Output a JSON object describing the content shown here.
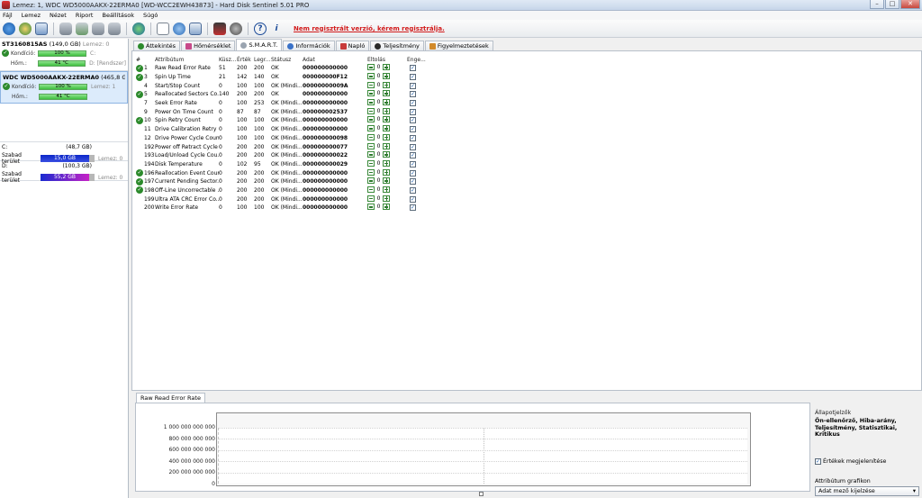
{
  "window": {
    "title": "Lemez: 1, WDC WD5000AAKX-22ERMA0 [WD-WCC2EWH43873]  -  Hard Disk Sentinel 5.01 PRO",
    "controls": {
      "minimize": "–",
      "maximize": "□",
      "close": "✕"
    }
  },
  "menu": [
    "Fájl",
    "Lemez",
    "Nézet",
    "Riport",
    "Beállítások",
    "Súgó"
  ],
  "toolbar": {
    "registration_note": "Nem regisztrált verzió, kérem regisztrálja.",
    "icons": [
      "refresh-icon",
      "disk-scan-icon",
      "report-icon",
      "disk-icon",
      "disk-icon",
      "disk-icon",
      "disk-icon",
      "globe-icon",
      "document-icon",
      "refresh-circle-icon",
      "email-icon",
      "chart-icon",
      "settings-icon",
      "help-icon",
      "info-icon"
    ],
    "help_glyph": "?",
    "info_glyph": "i"
  },
  "disks": [
    {
      "name": "ST3160815AS",
      "size": "(149,0 GB)",
      "lemez": "Lemez: 0",
      "cond_label": "Kondíció:",
      "cond_value": "100 %",
      "temp_label": "Hőm.:",
      "temp_value": "41 °C",
      "vol1": "C:",
      "vol2": "D:",
      "vol2_extra": "[Rendszer]",
      "selected": false
    },
    {
      "name": "WDC WD5000AAKX-22ERMA0",
      "size": "(465,8 GB)",
      "lemez": "Lemez: 1",
      "cond_label": "Kondíció:",
      "cond_value": "100 %",
      "temp_label": "Hőm.:",
      "temp_value": "41 °C",
      "selected": true
    }
  ],
  "volumes": [
    {
      "letter": "C:",
      "size": "(48,7 GB)",
      "free_label": "Szabad terület",
      "free_value": "15,0 GB",
      "lemez": "Lemez: 0",
      "free_fraction": 0.31
    },
    {
      "letter": "D:",
      "size": "(100,3 GB)",
      "free_label": "Szabad terület",
      "free_value": "55,2 GB",
      "lemez": "Lemez: 0",
      "free_fraction": 0.55
    }
  ],
  "tabs": [
    "Áttekintés",
    "Hőmérséklet",
    "S.M.A.R.T.",
    "Információk",
    "Napló",
    "Teljesítmény",
    "Figyelmeztetések"
  ],
  "active_tab": "S.M.A.R.T.",
  "smart": {
    "headers": {
      "num": "#",
      "attr": "Attribútum",
      "threshold": "Küsz...",
      "value": "Érték",
      "worst": "Legr...",
      "status": "Státusz",
      "data": "Adat",
      "offset": "Eltolás",
      "enabled": "Enge..."
    },
    "rows": [
      {
        "ok": true,
        "num": "1",
        "attr": "Raw Read Error Rate",
        "th": "51",
        "val": "200",
        "wr": "200",
        "st": "OK",
        "data": "000000000000"
      },
      {
        "ok": true,
        "num": "3",
        "attr": "Spin Up Time",
        "th": "21",
        "val": "142",
        "wr": "140",
        "st": "OK",
        "data": "000000000F12"
      },
      {
        "ok": false,
        "num": "4",
        "attr": "Start/Stop Count",
        "th": "0",
        "val": "100",
        "wr": "100",
        "st": "OK (Mindi...",
        "data": "00000000009A"
      },
      {
        "ok": true,
        "num": "5",
        "attr": "Reallocated Sectors Co...",
        "th": "140",
        "val": "200",
        "wr": "200",
        "st": "OK",
        "data": "000000000000"
      },
      {
        "ok": false,
        "num": "7",
        "attr": "Seek Error Rate",
        "th": "0",
        "val": "100",
        "wr": "253",
        "st": "OK (Mindi...",
        "data": "000000000000"
      },
      {
        "ok": false,
        "num": "9",
        "attr": "Power On Time Count",
        "th": "0",
        "val": "87",
        "wr": "87",
        "st": "OK (Mindi...",
        "data": "000000002537"
      },
      {
        "ok": true,
        "num": "10",
        "attr": "Spin Retry Count",
        "th": "0",
        "val": "100",
        "wr": "100",
        "st": "OK (Mindi...",
        "data": "000000000000"
      },
      {
        "ok": false,
        "num": "11",
        "attr": "Drive Calibration Retry ...",
        "th": "0",
        "val": "100",
        "wr": "100",
        "st": "OK (Mindi...",
        "data": "000000000000"
      },
      {
        "ok": false,
        "num": "12",
        "attr": "Drive Power Cycle Count",
        "th": "0",
        "val": "100",
        "wr": "100",
        "st": "OK (Mindi...",
        "data": "000000000098"
      },
      {
        "ok": false,
        "num": "192",
        "attr": "Power off Retract Cycle ...",
        "th": "0",
        "val": "200",
        "wr": "200",
        "st": "OK (Mindi...",
        "data": "000000000077"
      },
      {
        "ok": false,
        "num": "193",
        "attr": "Load/Unload Cycle Cou...",
        "th": "0",
        "val": "200",
        "wr": "200",
        "st": "OK (Mindi...",
        "data": "000000000022"
      },
      {
        "ok": false,
        "num": "194",
        "attr": "Disk Temperature",
        "th": "0",
        "val": "102",
        "wr": "95",
        "st": "OK (Mindi...",
        "data": "000000000029"
      },
      {
        "ok": true,
        "num": "196",
        "attr": "Reallocation Event Count",
        "th": "0",
        "val": "200",
        "wr": "200",
        "st": "OK (Mindi...",
        "data": "000000000000"
      },
      {
        "ok": true,
        "num": "197",
        "attr": "Current Pending Sector...",
        "th": "0",
        "val": "200",
        "wr": "200",
        "st": "OK (Mindi...",
        "data": "000000000000"
      },
      {
        "ok": true,
        "num": "198",
        "attr": "Off-Line Uncorrectable ...",
        "th": "0",
        "val": "200",
        "wr": "200",
        "st": "OK (Mindi...",
        "data": "000000000000"
      },
      {
        "ok": false,
        "num": "199",
        "attr": "Ultra ATA CRC Error Co...",
        "th": "0",
        "val": "200",
        "wr": "200",
        "st": "OK (Mindi...",
        "data": "000000000000"
      },
      {
        "ok": false,
        "num": "200",
        "attr": "Write Error Rate",
        "th": "0",
        "val": "100",
        "wr": "100",
        "st": "OK (Mindi...",
        "data": "000000000000"
      }
    ],
    "offset_value": "0"
  },
  "graph": {
    "tab": "Raw Read Error Rate",
    "yticks": [
      "1 000 000 000 000",
      "800 000 000 000",
      "600 000 000 000",
      "400 000 000 000",
      "200 000 000 000",
      "0"
    ]
  },
  "right_panel": {
    "heading": "Állapotjelzők",
    "indicators": "Ön-ellenőrző, Hiba-arány, Teljesítmény, Statisztikai, Kritikus",
    "show_values_label": "Értékek megjelenítése",
    "attr_graph_label": "Attribútum grafikon",
    "select_value": "Adat mező kijelzése"
  },
  "colors": {
    "ok_green": "#2c8a2c",
    "warning_red": "#d21b1b",
    "free_blue": "#0b26c8"
  }
}
